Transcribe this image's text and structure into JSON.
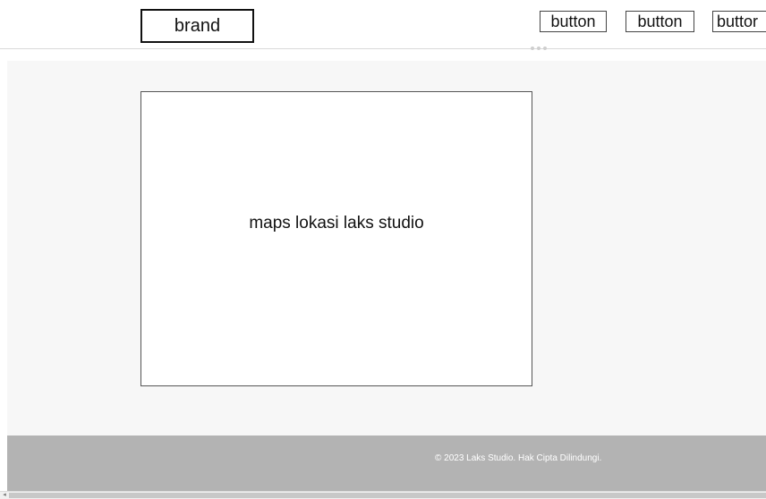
{
  "header": {
    "brand_label": "brand",
    "nav_buttons": [
      "button",
      "button",
      "buttor"
    ]
  },
  "main": {
    "map_placeholder": "maps lokasi laks studio"
  },
  "footer": {
    "copyright": "© 2023 Laks Studio. Hak Cipta Dilindungi."
  },
  "scrollbar": {
    "left_arrow": "◂"
  }
}
